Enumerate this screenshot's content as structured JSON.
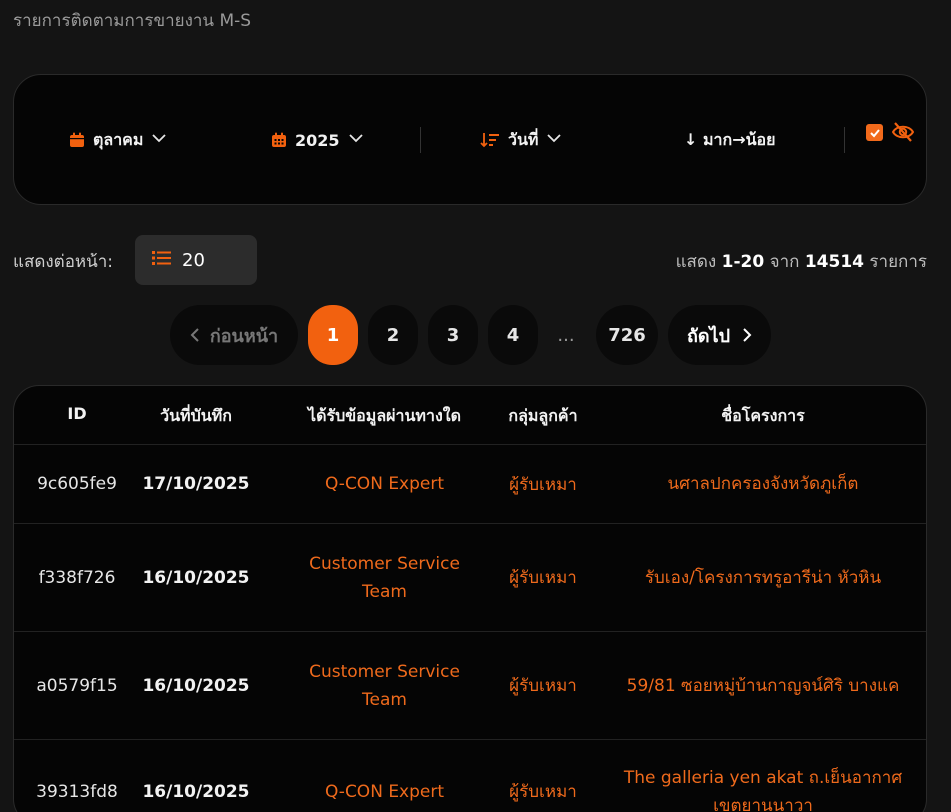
{
  "page": {
    "title": "รายการติดตามการขายงาน M-S"
  },
  "filters": {
    "month": {
      "label": "ตุลาคม",
      "icon": "calendar-icon"
    },
    "year": {
      "label": "2025",
      "icon": "calendar-grid-icon"
    },
    "sort_field": {
      "label": "วันที่",
      "icon": "sort-icon"
    },
    "sort_order": {
      "label": "↓ มาก→น้อย"
    },
    "show_checkbox": {
      "checked": true
    },
    "visibility_icon": "eye-slash-icon"
  },
  "per_page": {
    "label": "แสดงต่อหน้า:",
    "value": "20",
    "icon": "list-icon"
  },
  "summary": {
    "prefix": "แสดง",
    "range": "1-20",
    "from_word": "จาก",
    "total": "14514",
    "suffix": "รายการ"
  },
  "pagination": {
    "prev_label": "ก่อนหน้า",
    "pages": [
      "1",
      "2",
      "3",
      "4"
    ],
    "ellipsis": "...",
    "last_page": "726",
    "next_label": "ถัดไป",
    "current": "1"
  },
  "table": {
    "headers": [
      "ID",
      "วันที่บันทึก",
      "ได้รับข้อมูลผ่านทางใด",
      "กลุ่มลูกค้า",
      "ชื่อโครงการ"
    ],
    "rows": [
      {
        "id": "9c605fe9",
        "date": "17/10/2025",
        "source": "Q-CON Expert",
        "group": "ผู้รับเหมา",
        "project": "นศาลปกครองจังหวัดภูเก็ต"
      },
      {
        "id": "f338f726",
        "date": "16/10/2025",
        "source": "Customer Service Team",
        "group": "ผู้รับเหมา",
        "project": "รับเอง/โครงการทรูอารีน่า หัวหิน"
      },
      {
        "id": "a0579f15",
        "date": "16/10/2025",
        "source": "Customer Service Team",
        "group": "ผู้รับเหมา",
        "project": "59/81 ซอยหมู่บ้านกาญจน์ศิริ บางแค"
      },
      {
        "id": "39313fd8",
        "date": "16/10/2025",
        "source": "Q-CON Expert",
        "group": "ผู้รับเหมา",
        "project": "The galleria yen akat ถ.เย็นอากาศ เขตยานนาวา"
      }
    ]
  },
  "colors": {
    "accent": "#f2610f",
    "background": "#141414",
    "card": "#050505"
  }
}
